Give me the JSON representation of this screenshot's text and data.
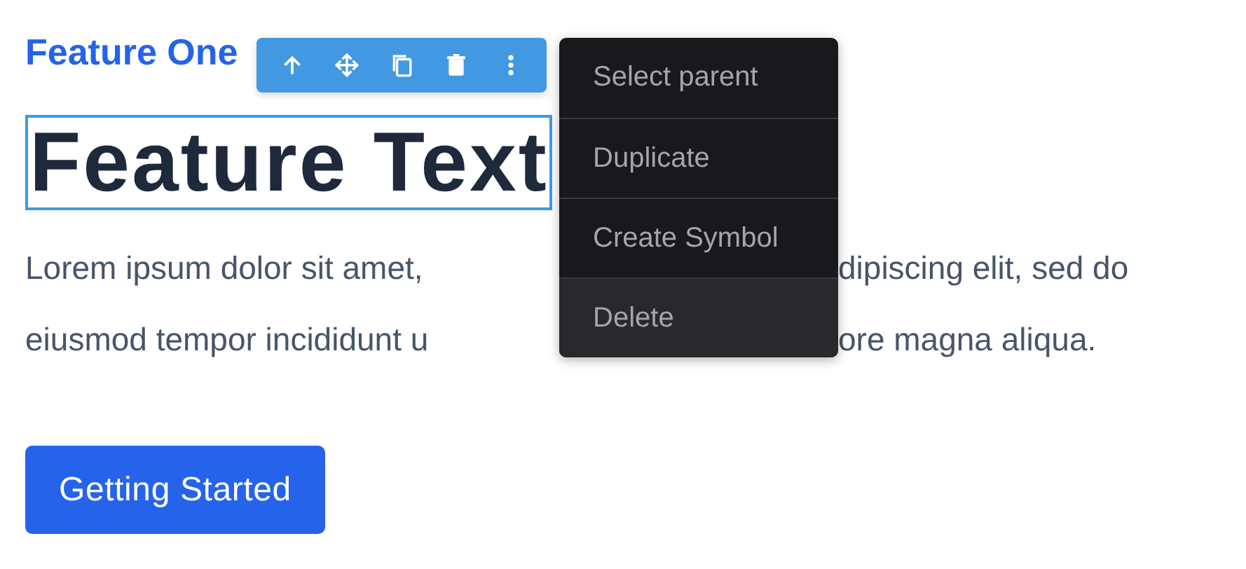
{
  "subtitle": "Feature One",
  "heading": {
    "text": "Feature Text",
    "selected": true
  },
  "paragraph_lines": [
    {
      "left": "Lorem ipsum dolor sit amet,",
      "right": "dipiscing elit, sed do"
    },
    {
      "left": "eiusmod tempor incididunt u",
      "right": "ore magna aliqua."
    }
  ],
  "button": "Getting Started",
  "toolbar": [
    {
      "kind": "up"
    },
    {
      "kind": "move"
    },
    {
      "kind": "copy"
    },
    {
      "kind": "trash"
    },
    {
      "kind": "more"
    }
  ],
  "context_menu": [
    {
      "label": "Select parent",
      "selected": false
    },
    {
      "label": "Duplicate",
      "selected": false
    },
    {
      "label": "Create Symbol",
      "selected": false
    },
    {
      "label": "Delete",
      "selected": true
    }
  ]
}
